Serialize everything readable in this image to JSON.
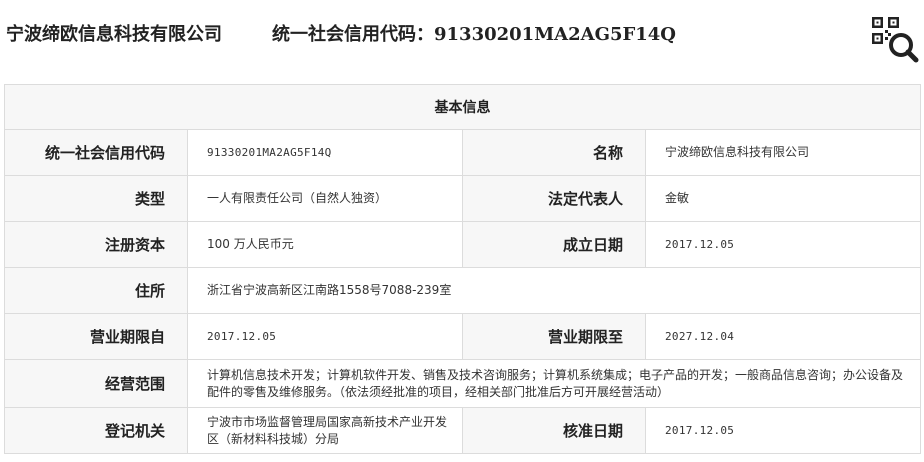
{
  "header": {
    "company_name": "宁波缔欧信息科技有限公司",
    "credit_code_label": "统一社会信用代码：",
    "credit_code_value": "91330201MA2AG5F14Q",
    "qr_icon": "qr-search-icon"
  },
  "table": {
    "title": "基本信息",
    "rows": [
      {
        "label": "统一社会信用代码",
        "value": "91330201MA2AG5F14Q",
        "label2": "名称",
        "value2": "宁波缔欧信息科技有限公司"
      },
      {
        "label": "类型",
        "value": "一人有限责任公司（自然人独资）",
        "label2": "法定代表人",
        "value2": "金敏"
      },
      {
        "label": "注册资本",
        "value": "100 万人民币元",
        "label2": "成立日期",
        "value2": "2017.12.05"
      },
      {
        "label": "住所",
        "value": "浙江省宁波高新区江南路1558号7088-239室"
      },
      {
        "label": "营业期限自",
        "value": "2017.12.05",
        "label2": "营业期限至",
        "value2": "2027.12.04"
      },
      {
        "label": "经营范围",
        "value": "计算机信息技术开发；计算机软件开发、销售及技术咨询服务；计算机系统集成；电子产品的开发；一般商品信息咨询；办公设备及配件的零售及维修服务。（依法须经批准的项目，经相关部门批准后方可开展经营活动）"
      },
      {
        "label": "登记机关",
        "value": "宁波市市场监督管理局国家高新技术产业开发区（新材料科技城）分局",
        "label2": "核准日期",
        "value2": "2017.12.05"
      }
    ]
  }
}
